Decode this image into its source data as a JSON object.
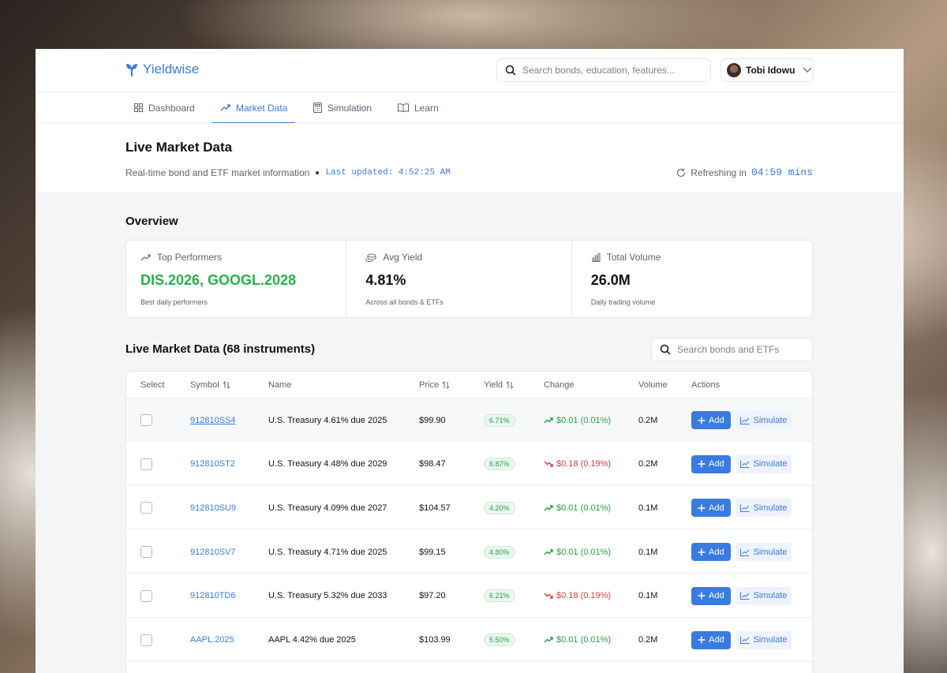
{
  "app": {
    "brand": "Yieldwise",
    "search_placeholder": "Search bonds, education, features...",
    "user_name": "Tobi Idowu"
  },
  "nav": {
    "tabs": [
      {
        "label": "Dashboard",
        "icon": "grid-icon"
      },
      {
        "label": "Market Data",
        "icon": "trending-up-icon",
        "active": true
      },
      {
        "label": "Simulation",
        "icon": "calculator-icon"
      },
      {
        "label": "Learn",
        "icon": "book-open-icon"
      }
    ]
  },
  "header": {
    "title": "Live Market Data",
    "subtitle": "Real-time bond and ETF market information",
    "last_updated": "Last updated: 4:52:25 AM",
    "refreshing_label": "Refreshing in",
    "refreshing_time": "04:59 mins"
  },
  "overview": {
    "title": "Overview",
    "cards": [
      {
        "label": "Top Performers",
        "value": "DIS.2026, GOOGL.2028",
        "sub": "Best daily performers",
        "icon": "trending-up-icon"
      },
      {
        "label": "Avg Yield",
        "value": "4.81%",
        "sub": "Across all bonds & ETFs",
        "icon": "coins-icon"
      },
      {
        "label": "Total Volume",
        "value": "26.0M",
        "sub": "Daily trading volume",
        "icon": "bar-chart-icon"
      }
    ]
  },
  "table": {
    "title": "Live Market Data (68 instruments)",
    "search_placeholder": "Search bonds and ETFs",
    "columns": {
      "select": "Select",
      "symbol": "Symbol",
      "name": "Name",
      "price": "Price",
      "yield": "Yield",
      "change": "Change",
      "volume": "Volume",
      "actions": "Actions"
    },
    "add_label": "Add",
    "simulate_label": "Simulate",
    "rows": [
      {
        "symbol": "912810SS4",
        "name": "U.S. Treasury 4.61% due 2025",
        "price": "$99.90",
        "yield": "6.71%",
        "change": "$0.01 (0.01%)",
        "direction": "up",
        "volume": "0.2M"
      },
      {
        "symbol": "912810ST2",
        "name": "U.S. Treasury 4.48% due 2029",
        "price": "$98.47",
        "yield": "6.87%",
        "change": "$0.18 (0.19%)",
        "direction": "down",
        "volume": "0.2M"
      },
      {
        "symbol": "912810SU9",
        "name": "U.S. Treasury 4.09% due 2027",
        "price": "$104.57",
        "yield": "4.20%",
        "change": "$0.01 (0.01%)",
        "direction": "up",
        "volume": "0.1M"
      },
      {
        "symbol": "912810SV7",
        "name": "U.S. Treasury 4.71% due 2025",
        "price": "$99.15",
        "yield": "4.80%",
        "change": "$0.01 (0.01%)",
        "direction": "up",
        "volume": "0.1M"
      },
      {
        "symbol": "912810TD6",
        "name": "U.S. Treasury 5.32% due 2033",
        "price": "$97.20",
        "yield": "6.21%",
        "change": "$0.18 (0.19%)",
        "direction": "down",
        "volume": "0.1M"
      },
      {
        "symbol": "AAPL.2025",
        "name": "AAPL 4.42% due 2025",
        "price": "$103.99",
        "yield": "5.50%",
        "change": "$0.01 (0.01%)",
        "direction": "up",
        "volume": "0.2M"
      }
    ]
  },
  "colors": {
    "accent": "#3a7be0",
    "positive": "#23a047",
    "negative": "#e03b3b"
  }
}
